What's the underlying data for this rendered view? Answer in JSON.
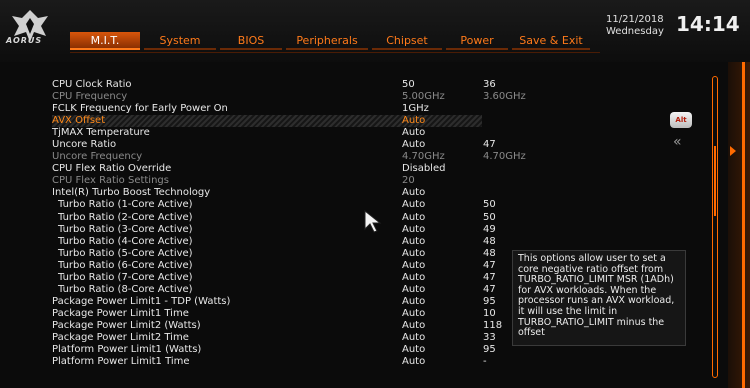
{
  "brand": "AORUS",
  "tabs": [
    {
      "label": "M.I.T."
    },
    {
      "label": "System"
    },
    {
      "label": "BIOS"
    },
    {
      "label": "Peripherals"
    },
    {
      "label": "Chipset"
    },
    {
      "label": "Power"
    },
    {
      "label": "Save & Exit"
    }
  ],
  "datetime": {
    "date": "11/21/2018",
    "day": "Wednesday",
    "time": "14:14"
  },
  "rows": [
    {
      "label": "CPU Clock Ratio",
      "v1": "50",
      "v2": "36"
    },
    {
      "label": "CPU Frequency",
      "v1": "5.00GHz",
      "v2": "3.60GHz"
    },
    {
      "label": "FCLK Frequency for Early Power On",
      "v1": "1GHz",
      "v2": ""
    },
    {
      "label": "AVX Offset",
      "v1": "Auto",
      "v2": ""
    },
    {
      "label": "TjMAX Temperature",
      "v1": "Auto",
      "v2": ""
    },
    {
      "label": "Uncore Ratio",
      "v1": "Auto",
      "v2": "47"
    },
    {
      "label": "Uncore Frequency",
      "v1": "4.70GHz",
      "v2": "4.70GHz"
    },
    {
      "label": "CPU Flex Ratio Override",
      "v1": "Disabled",
      "v2": ""
    },
    {
      "label": "CPU Flex Ratio Settings",
      "v1": "20",
      "v2": ""
    },
    {
      "label": "Intel(R) Turbo Boost Technology",
      "v1": "Auto",
      "v2": ""
    },
    {
      "label": "Turbo Ratio (1-Core Active)",
      "v1": "Auto",
      "v2": "50"
    },
    {
      "label": "Turbo Ratio (2-Core Active)",
      "v1": "Auto",
      "v2": "50"
    },
    {
      "label": "Turbo Ratio (3-Core Active)",
      "v1": "Auto",
      "v2": "49"
    },
    {
      "label": "Turbo Ratio (4-Core Active)",
      "v1": "Auto",
      "v2": "48"
    },
    {
      "label": "Turbo Ratio (5-Core Active)",
      "v1": "Auto",
      "v2": "48"
    },
    {
      "label": "Turbo Ratio (6-Core Active)",
      "v1": "Auto",
      "v2": "47"
    },
    {
      "label": "Turbo Ratio (7-Core Active)",
      "v1": "Auto",
      "v2": "47"
    },
    {
      "label": "Turbo Ratio (8-Core Active)",
      "v1": "Auto",
      "v2": "47"
    },
    {
      "label": "Package Power Limit1 - TDP (Watts)",
      "v1": "Auto",
      "v2": "95"
    },
    {
      "label": "Package Power Limit1 Time",
      "v1": "Auto",
      "v2": "10"
    },
    {
      "label": "Package Power Limit2 (Watts)",
      "v1": "Auto",
      "v2": "118"
    },
    {
      "label": "Package Power Limit2 Time",
      "v1": "Auto",
      "v2": "33"
    },
    {
      "label": "Platform Power Limit1 (Watts)",
      "v1": "Auto",
      "v2": "95"
    },
    {
      "label": "Platform Power Limit1 Time",
      "v1": "Auto",
      "v2": "-"
    }
  ],
  "help_text": "This options allow user to set a core negative ratio offset from TURBO_RATIO_LIMIT MSR (1ADh) for AVX workloads. When the processor runs an AVX workload, it will use the limit in TURBO_RATIO_LIMIT minus the offset",
  "alt_label": "Alt",
  "collapse_glyph": "«",
  "accent_color": "#ff6a00",
  "scroll_position": 0.25
}
